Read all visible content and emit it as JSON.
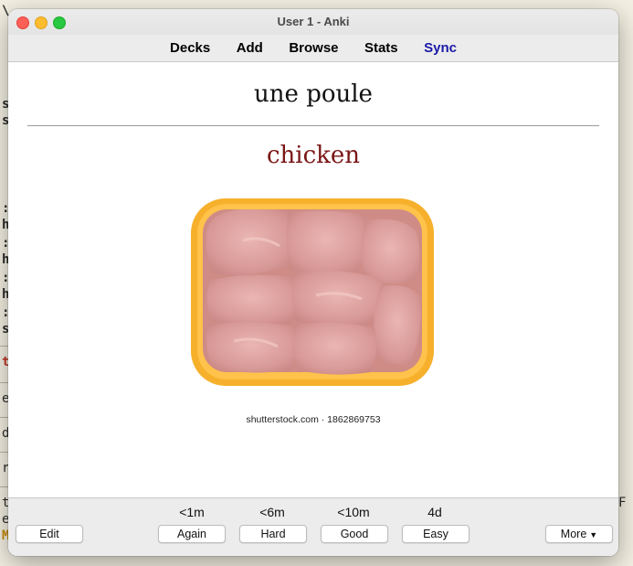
{
  "window": {
    "title": "User 1 - Anki"
  },
  "nav": {
    "decks": "Decks",
    "add": "Add",
    "browse": "Browse",
    "stats": "Stats",
    "sync": "Sync"
  },
  "card": {
    "front": "une poule",
    "back": "chicken",
    "image_credit": "shutterstock.com · 1862869753"
  },
  "answer": {
    "again": {
      "interval": "<1m",
      "label": "Again"
    },
    "hard": {
      "interval": "<6m",
      "label": "Hard"
    },
    "good": {
      "interval": "<10m",
      "label": "Good"
    },
    "easy": {
      "interval": "4d",
      "label": "Easy"
    }
  },
  "bottom": {
    "edit": "Edit",
    "more": "More"
  },
  "colors": {
    "sync_link": "#1a1aa8",
    "answer_text": "#7a1616",
    "tray": "#f6b02b"
  },
  "icons": {
    "close": "close-dot-icon",
    "minimize": "minimize-dot-icon",
    "maximize": "maximize-dot-icon",
    "more_menu": "caret-down-icon"
  }
}
